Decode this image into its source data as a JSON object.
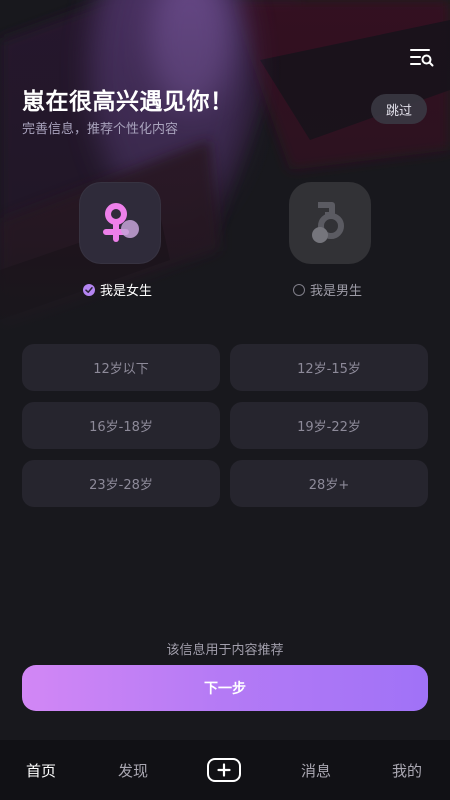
{
  "header": {
    "title": "崽在很高兴遇见你！",
    "subtitle": "完善信息，推荐个性化内容",
    "skip_label": "跳过",
    "filter_icon": "filter-search-icon"
  },
  "gender": {
    "options": [
      {
        "label": "我是女生",
        "icon": "female-icon",
        "selected": true
      },
      {
        "label": "我是男生",
        "icon": "male-icon",
        "selected": false
      }
    ]
  },
  "age_ranges": [
    "12岁以下",
    "12岁-15岁",
    "16岁-18岁",
    "19岁-22岁",
    "23岁-28岁",
    "28岁+"
  ],
  "footer": {
    "hint": "该信息用于内容推荐",
    "next_label": "下一步"
  },
  "tabbar": {
    "items": [
      "首页",
      "发现",
      "消息",
      "我的"
    ],
    "active": "首页",
    "add_icon": "plus-icon"
  },
  "colors": {
    "background": "#18181d",
    "accent_start": "#d287f5",
    "accent_end": "#a072f7",
    "female_accent": "#ec7de8",
    "tile_bg": "#26252e"
  }
}
